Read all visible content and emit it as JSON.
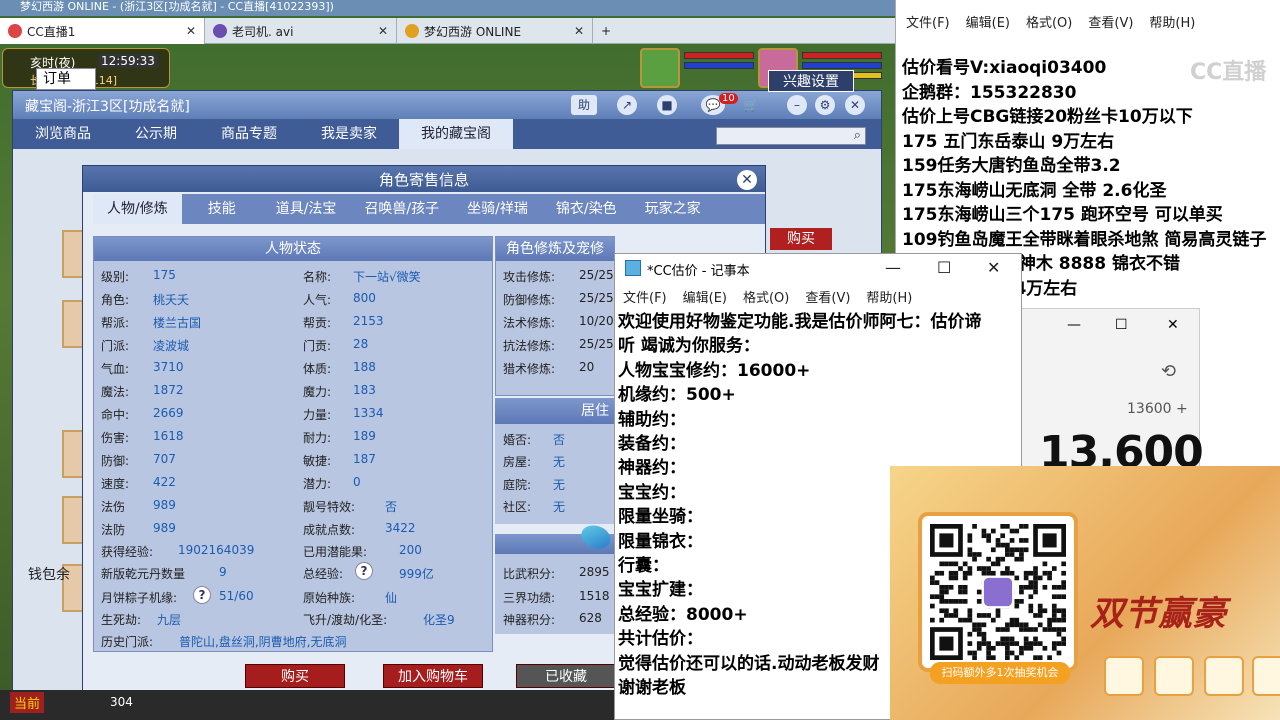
{
  "browser": {
    "title_strip": "梦幻西游 ONLINE - (浙江3区[功成名就] - CC直播[41022393])",
    "tabs": [
      {
        "label": "CC直播1",
        "active": true
      },
      {
        "label": "老司机. avi",
        "active": false
      },
      {
        "label": "梦幻西游 ONLINE",
        "active": false
      }
    ],
    "new_tab": "+"
  },
  "hud": {
    "time_label": "亥时(夜)",
    "clock": "12:59:33",
    "place": "长寿村[122,114]"
  },
  "cbg": {
    "title": "藏宝阁-浙江3区[功成名就]",
    "help": "助",
    "badge": "10",
    "nav": [
      "浏览商品",
      "公示期",
      "商品专题",
      "我是卖家",
      "我的藏宝阁"
    ],
    "order": "订单",
    "interest": "兴趣设置",
    "buy": "购买",
    "wallet": "钱包余"
  },
  "modal": {
    "title": "角色寄售信息",
    "tabs": [
      "人物/修炼",
      "技能",
      "道具/法宝",
      "召唤兽/孩子",
      "坐骑/祥瑞",
      "锦衣/染色",
      "玩家之家"
    ],
    "left_head": "人物状态",
    "right_head": "角色修炼及宠修",
    "right2_head": "居住",
    "stats_left": [
      {
        "k": "级别:",
        "v": "175"
      },
      {
        "k": "角色:",
        "v": "桃夭夭"
      },
      {
        "k": "帮派:",
        "v": "楼兰古国"
      },
      {
        "k": "门派:",
        "v": "凌波城"
      },
      {
        "k": "气血:",
        "v": "3710"
      },
      {
        "k": "魔法:",
        "v": "1872"
      },
      {
        "k": "命中:",
        "v": "2669"
      },
      {
        "k": "伤害:",
        "v": "1618"
      },
      {
        "k": "防御:",
        "v": "707"
      },
      {
        "k": "速度:",
        "v": "422"
      },
      {
        "k": "法伤",
        "v": "989"
      },
      {
        "k": "法防",
        "v": "989"
      }
    ],
    "stats_mid": [
      {
        "k": "名称:",
        "v": "下一站√微笑"
      },
      {
        "k": "人气:",
        "v": "800"
      },
      {
        "k": "帮贡:",
        "v": "2153"
      },
      {
        "k": "门贡:",
        "v": "28"
      },
      {
        "k": "体质:",
        "v": "188"
      },
      {
        "k": "魔力:",
        "v": "183"
      },
      {
        "k": "力量:",
        "v": "1334"
      },
      {
        "k": "耐力:",
        "v": "189"
      },
      {
        "k": "敏捷:",
        "v": "187"
      },
      {
        "k": "潜力:",
        "v": "0"
      },
      {
        "k": "靓号特效:",
        "v": "否"
      },
      {
        "k": "成就点数:",
        "v": "3422"
      }
    ],
    "exp_label": "获得经验:",
    "exp_value": "1902164039",
    "used_label": "已用潜能果:",
    "used_value": "200",
    "qyd_label": "新版乾元丹数量",
    "qyd_value": "9",
    "total_label": "总经验:",
    "total_value": "999亿",
    "yb_label": "月饼粽子机缘:",
    "yb_value": "51/60",
    "race_label": "原始种族:",
    "race_value": "仙",
    "sm_label": "生死劫:",
    "sm_value": "九层",
    "fs_label": "飞升/渡劫/化圣:",
    "fs_value": "化圣9",
    "history_label": "历史门派:",
    "history_value": "普陀山,盘丝洞,阴曹地府,无底洞",
    "train": [
      {
        "k": "攻击修炼:",
        "v": "25/25"
      },
      {
        "k": "防御修炼:",
        "v": "25/25"
      },
      {
        "k": "法术修炼:",
        "v": "10/20"
      },
      {
        "k": "抗法修炼:",
        "v": "25/25"
      },
      {
        "k": "猎术修炼:",
        "v": "20"
      }
    ],
    "home": [
      {
        "k": "婚否:",
        "v": "否"
      },
      {
        "k": "房屋:",
        "v": "无"
      },
      {
        "k": "庭院:",
        "v": "无"
      },
      {
        "k": "社区:",
        "v": "无"
      }
    ],
    "scores": [
      {
        "k": "比武积分:",
        "v": "2895"
      },
      {
        "k": "三界功绩:",
        "v": "1518"
      },
      {
        "k": "神器积分:",
        "v": "628"
      }
    ],
    "btn_buy": "购买",
    "btn_cart": "加入购物车",
    "btn_fav": "已收藏",
    "q_mark": "?"
  },
  "bottom": {
    "current": "当前",
    "num": "304"
  },
  "notepad_big": {
    "menu": [
      "文件(F)",
      "编辑(E)",
      "格式(O)",
      "查看(V)",
      "帮助(H)"
    ],
    "lines": [
      "估价看号V:xiaoqi03400",
      "企鹅群：155322830",
      "估价上号CBG链接20粉丝卡10万以下",
      "175 五门东岳泰山  9万左右",
      "159任务大唐钓鱼岛全带3.2",
      "175东海崂山无底洞  全带   2.6化圣",
      "175东海崂山三个175 跑环空号 可以单买",
      "109钓鱼岛魔王全带眯着眼杀地煞 简易高灵链子",
      "              任务神木 8888 锦衣不错",
      "                1 4万左右"
    ],
    "watermark": "CC直播"
  },
  "calculator": {
    "history_icon": "⟲",
    "expression": "13600 +",
    "value": "13,600"
  },
  "notepad": {
    "title": "*CC估价 - 记事本",
    "menu": [
      "文件(F)",
      "编辑(E)",
      "格式(O)",
      "查看(V)",
      "帮助(H)"
    ],
    "lines": [
      "欢迎使用好物鉴定功能.我是估价师阿七：估价谛",
      "听 竭诚为你服务：",
      "人物宝宝修约：16000+",
      "机缘约：500+",
      "辅助约：",
      "装备约：",
      "神器约：",
      "宝宝约：",
      "限量坐骑：",
      "限量锦衣：",
      "行囊：",
      "宝宝扩建：",
      "总经验：8000+",
      "共计估价：",
      "觉得估价还可以的话.动动老板发财",
      "谢谢老板"
    ]
  },
  "ad": {
    "caption": "扫码额外多1次抽奖机会",
    "title": "双节赢豪"
  },
  "colors": {
    "accent": "#5d7bb3",
    "buy_red": "#a51d1d"
  }
}
